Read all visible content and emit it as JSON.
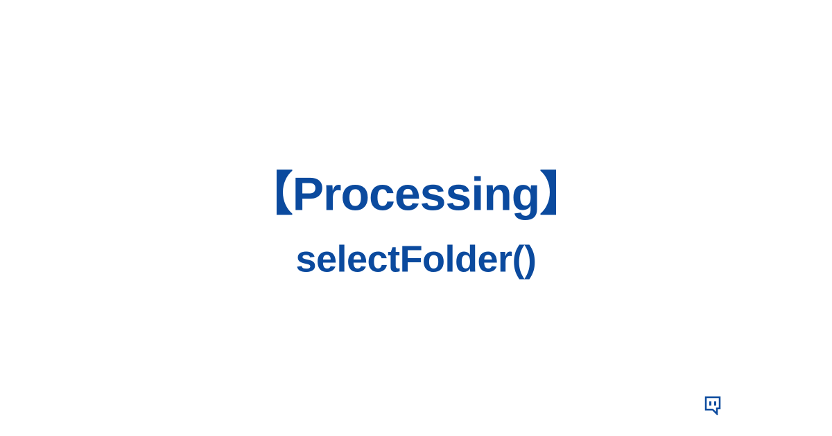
{
  "main": {
    "title": "【Processing】",
    "subtitle": "selectFolder()"
  },
  "colors": {
    "text": "#0b4a9e",
    "logo": "#0b4a9e"
  }
}
